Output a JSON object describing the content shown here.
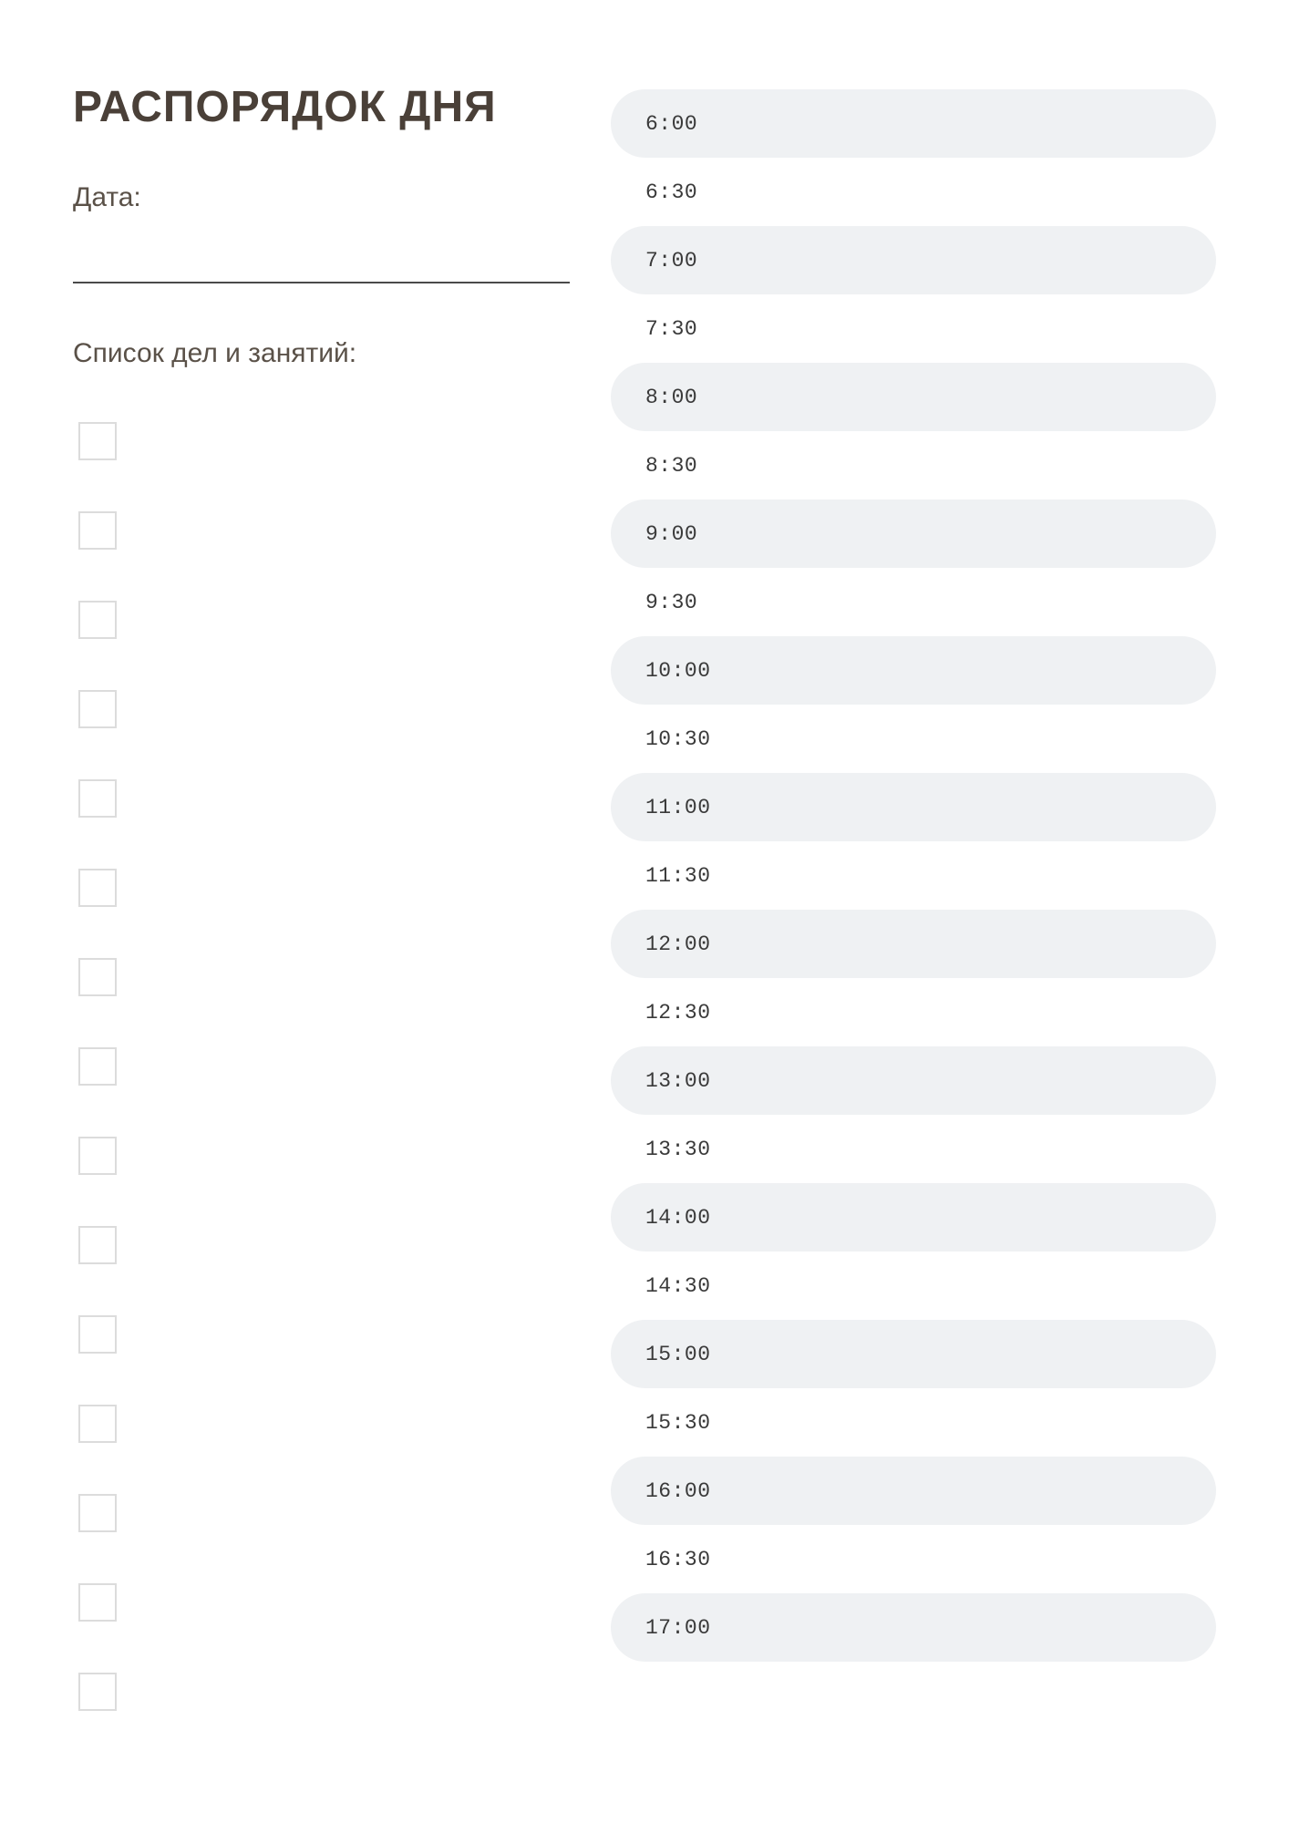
{
  "title": "РАСПОРЯДОК ДНЯ",
  "date_label": "Дата:",
  "tasks_label": "Список дел и занятий:",
  "checkbox_count": 15,
  "time_slots": [
    "6:00",
    "6:30",
    "7:00",
    "7:30",
    "8:00",
    "8:30",
    "9:00",
    "9:30",
    "10:00",
    "10:30",
    "11:00",
    "11:30",
    "12:00",
    "12:30",
    "13:00",
    "13:30",
    "14:00",
    "14:30",
    "15:00",
    "15:30",
    "16:00",
    "16:30",
    "17:00"
  ]
}
